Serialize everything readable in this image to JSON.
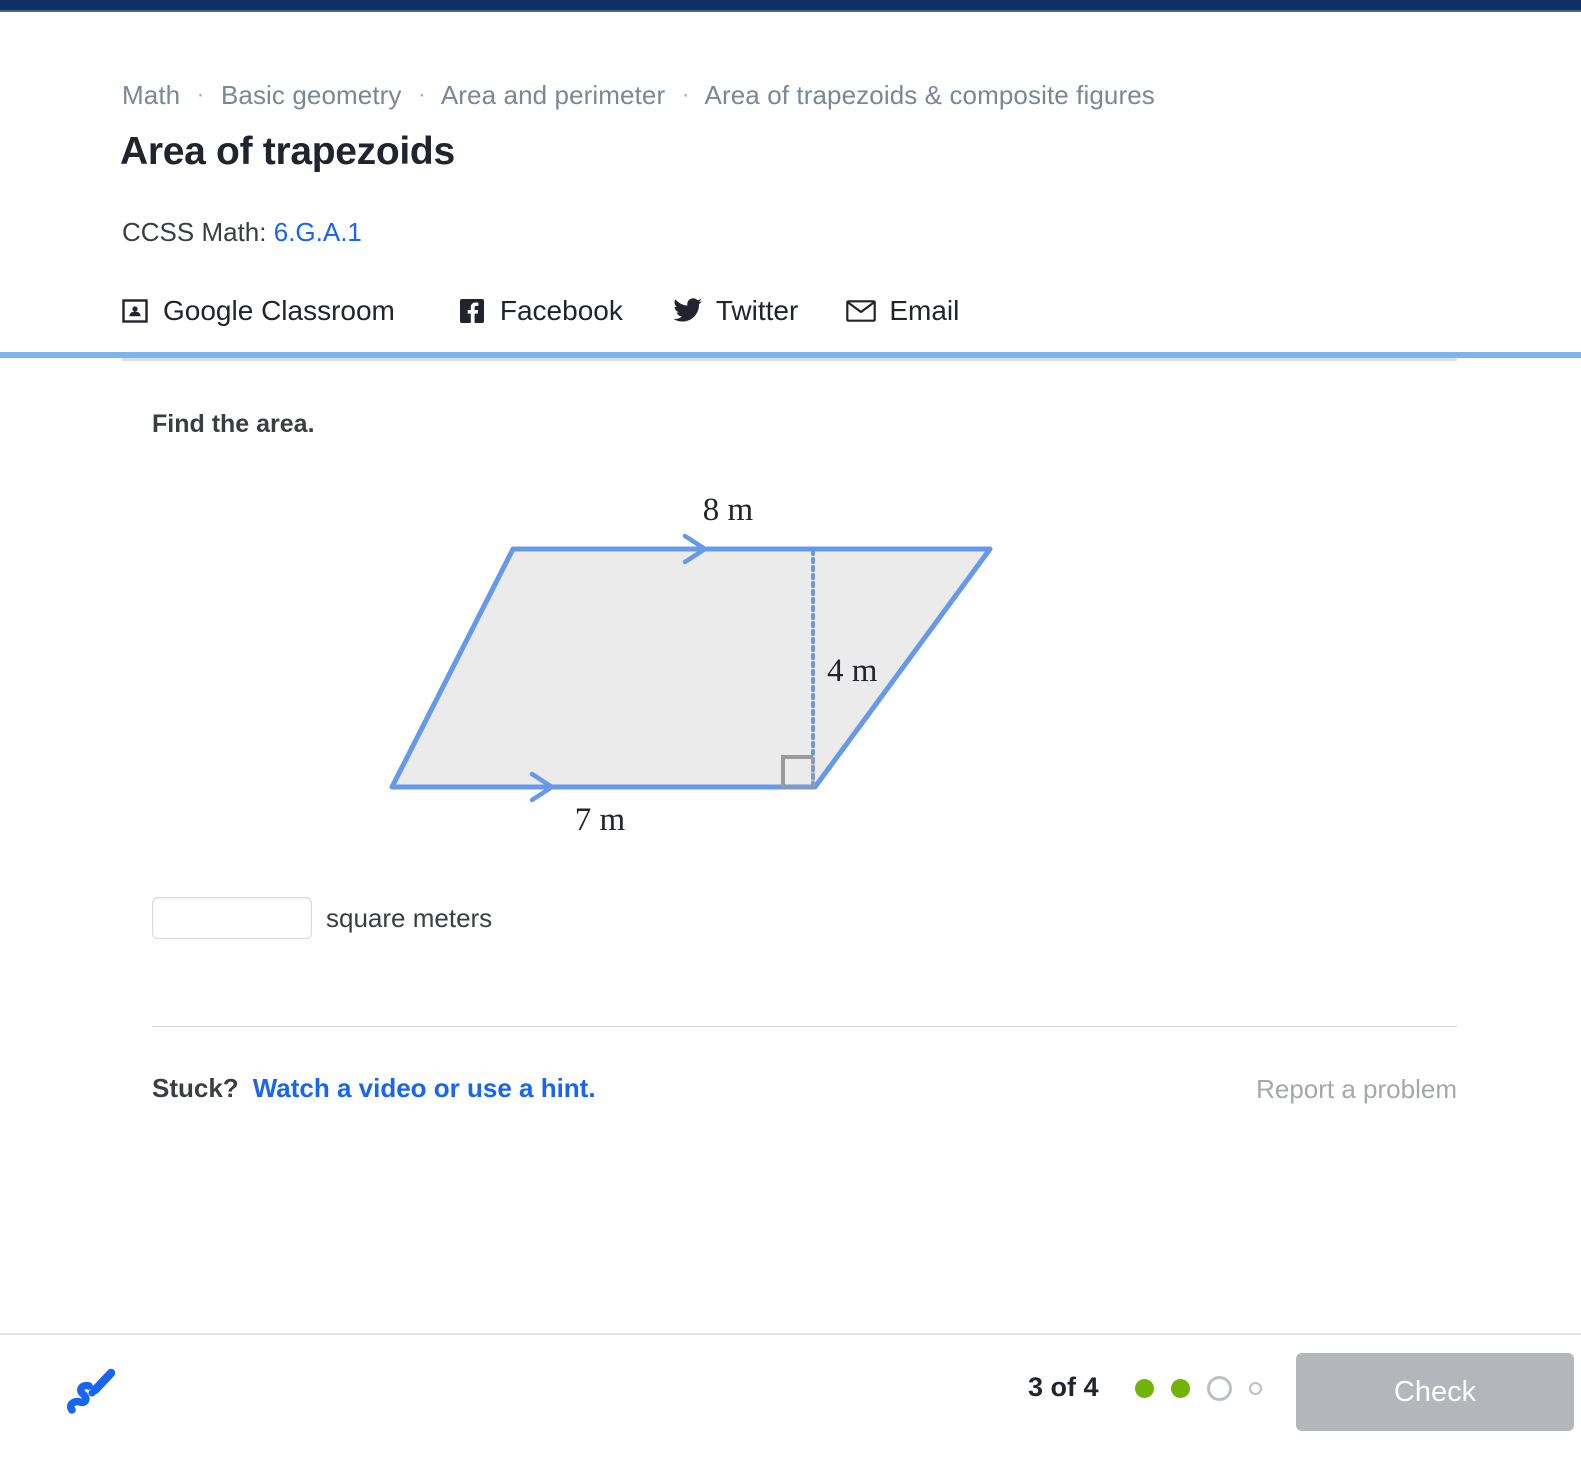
{
  "topbar": {
    "color": "#0e3065"
  },
  "header": {
    "breadcrumb": [
      {
        "label": "Math"
      },
      {
        "label": "Basic geometry"
      },
      {
        "label": "Area and perimeter"
      },
      {
        "label": "Area of trapezoids & composite figures"
      }
    ],
    "separator": "·",
    "title": "Area of trapezoids",
    "ccss_label": "CCSS Math:",
    "ccss_code": "6.G.A.1",
    "link_color": "#1865f2"
  },
  "share": {
    "items": [
      {
        "icon": "google-classroom-icon",
        "label": "Google Classroom"
      },
      {
        "icon": "facebook-icon",
        "label": "Facebook"
      },
      {
        "icon": "twitter-icon",
        "label": "Twitter"
      },
      {
        "icon": "email-icon",
        "label": "Email"
      }
    ]
  },
  "exercise": {
    "prompt": "Find the area.",
    "answer_value": "",
    "answer_placeholder": "",
    "answer_unit": "square meters",
    "stuck_label": "Stuck?",
    "stuck_link": "Watch a video or use a hint.",
    "report_link": "Report a problem"
  },
  "figure": {
    "shape": "trapezoid",
    "fill_color": "#ebebeb",
    "stroke_color": "#6699e8",
    "height_line_color": "#6699e8",
    "right_angle_color": "#9b9b9b",
    "labels": {
      "top": "8 m",
      "bottom": "7 m",
      "height": "4 m"
    },
    "values": {
      "top_base": 8,
      "bottom_base": 7,
      "height": 4,
      "unit": "m"
    },
    "tick_marks": "single arrow on top and bottom (parallel sides)"
  },
  "footer": {
    "logo": "khan-academy-logo",
    "logo_color": "#1865f2",
    "progress_text": "3 of 4",
    "dots": [
      {
        "state": "filled"
      },
      {
        "state": "filled"
      },
      {
        "state": "current"
      },
      {
        "state": "empty"
      }
    ],
    "dot_filled_color": "#71b307",
    "check_label": "Check",
    "check_enabled": false
  }
}
